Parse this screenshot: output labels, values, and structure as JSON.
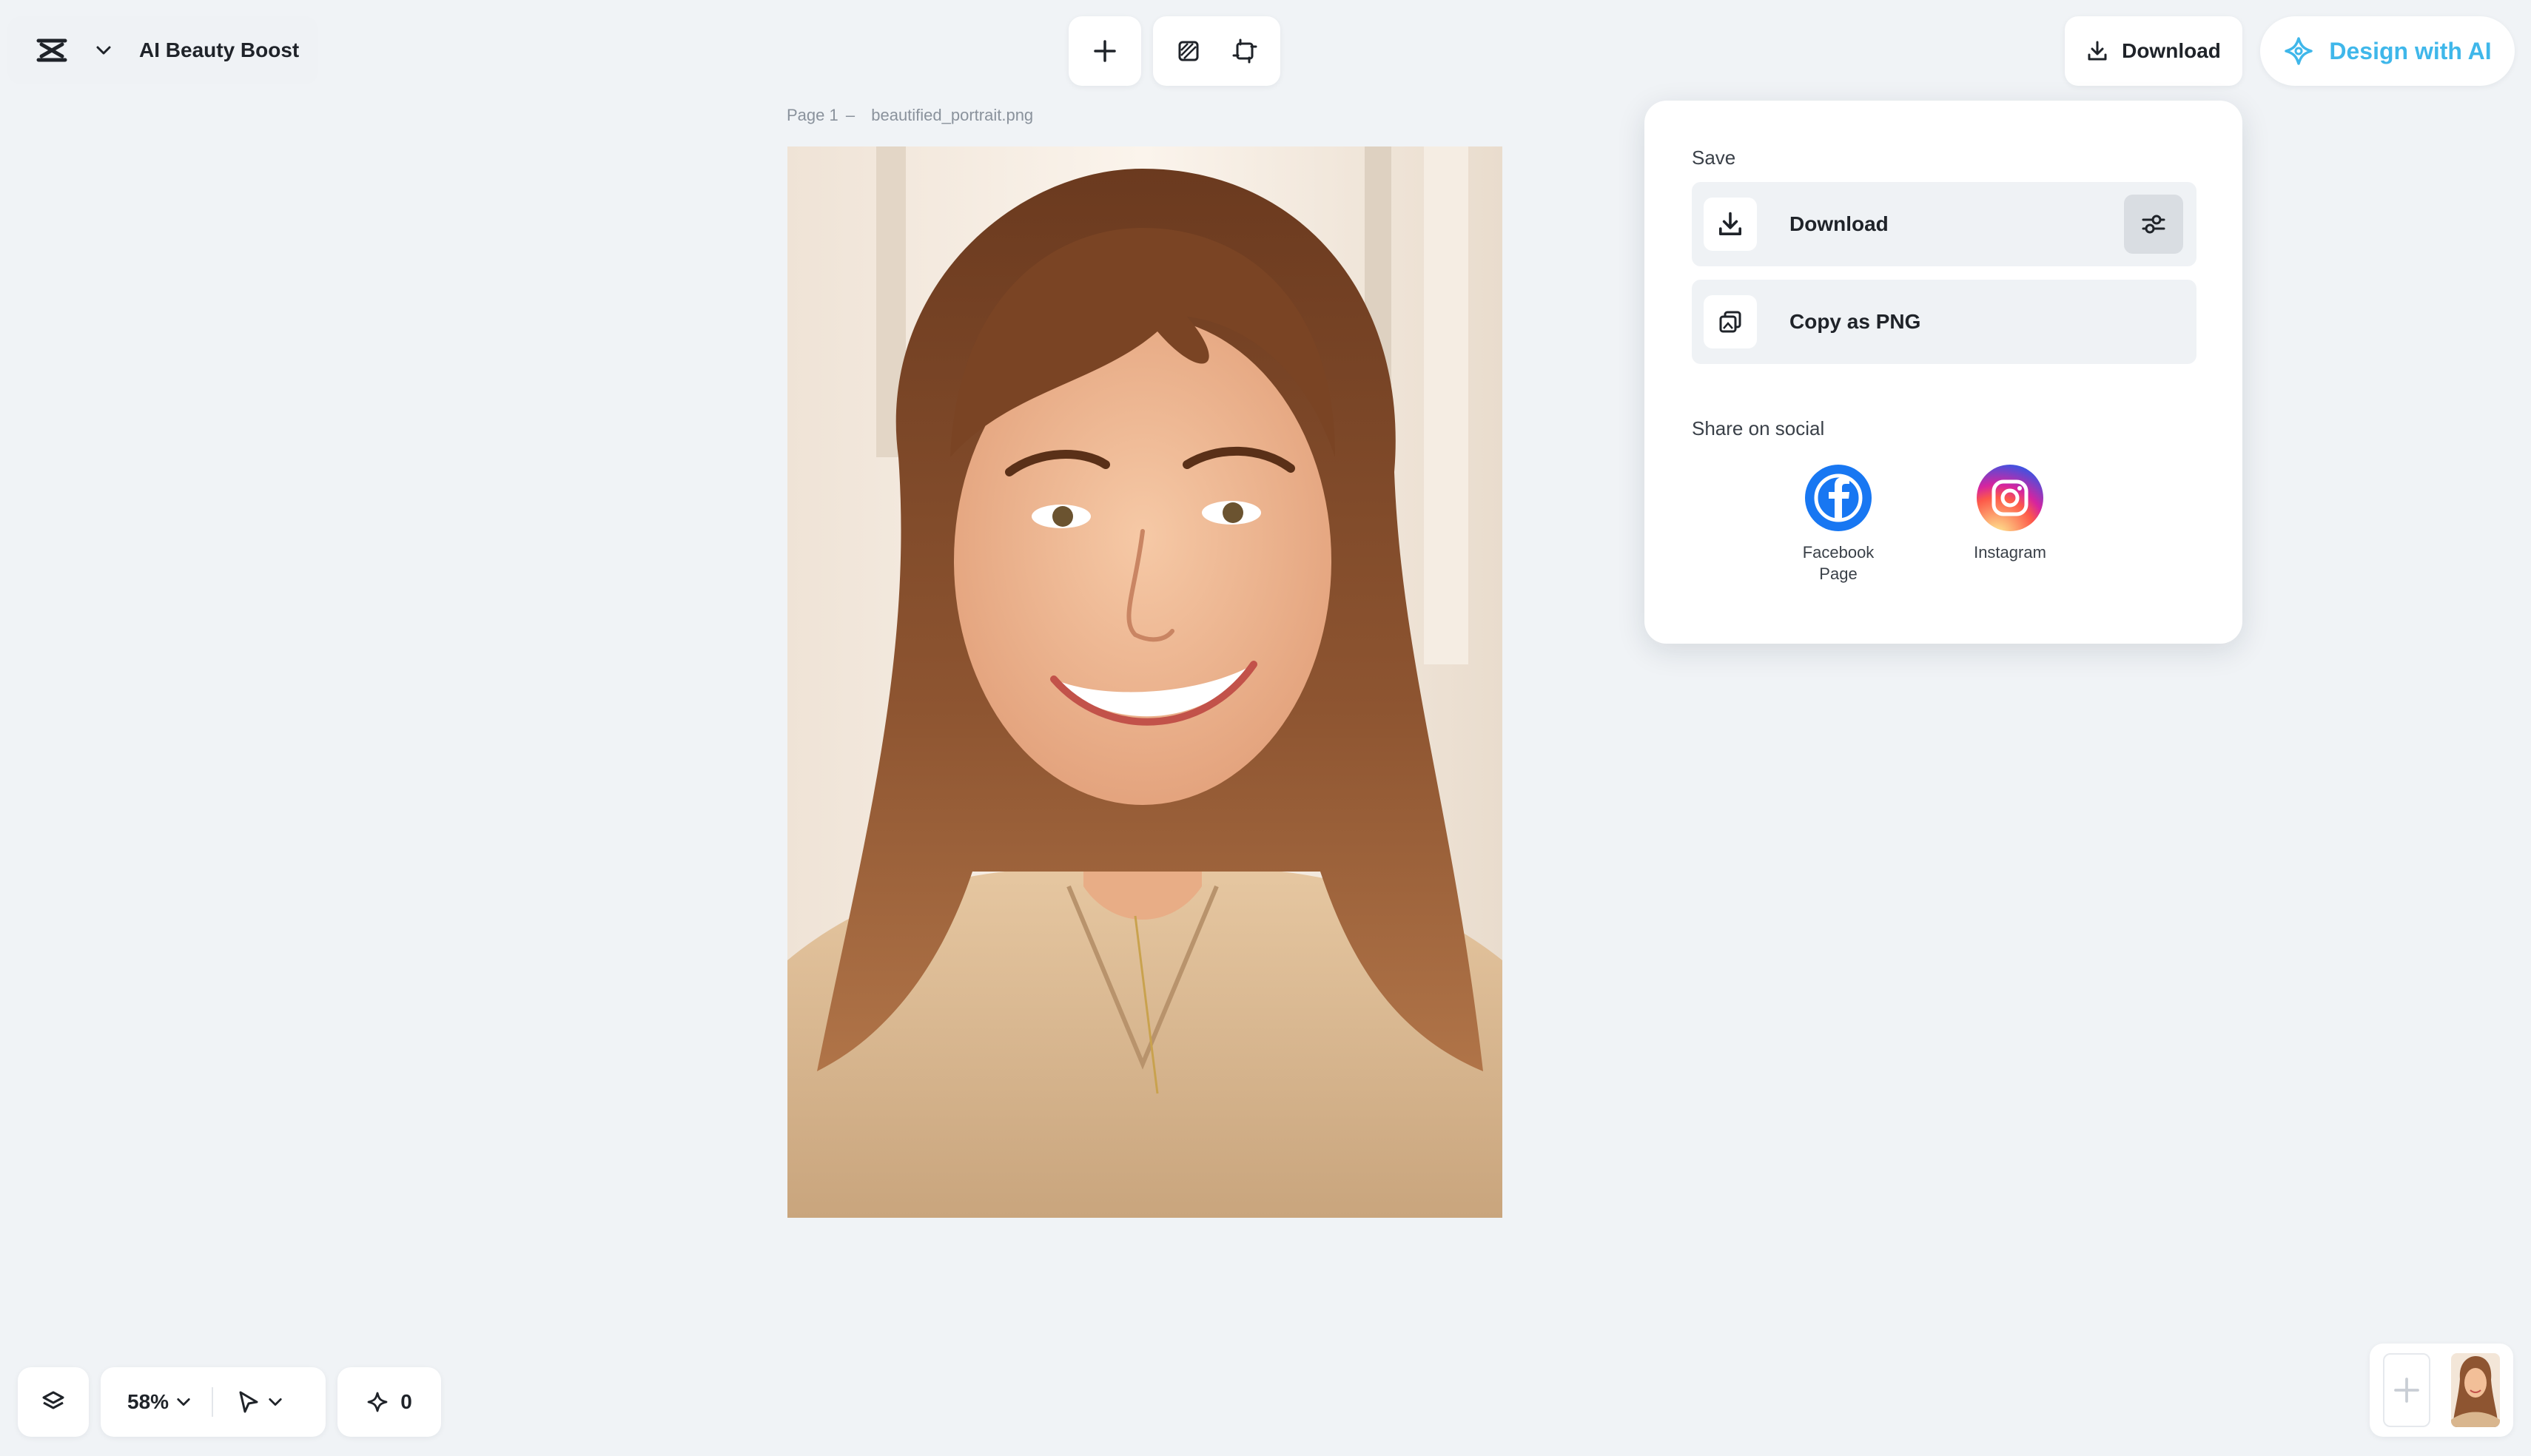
{
  "app": {
    "title": "AI Beauty Boost",
    "logo_icon": "capcut-logo-icon"
  },
  "toolbar": {
    "add_icon": "plus-icon",
    "tool_icons": [
      "background-remove-icon",
      "resize-icon"
    ]
  },
  "header": {
    "download_label": "Download",
    "design_ai_label": "Design with AI",
    "accent_color": "#3fb7ea"
  },
  "canvas": {
    "page_label": "Page 1",
    "separator": "–",
    "file_name": "beautified_portrait.png"
  },
  "download_menu": {
    "save_heading": "Save",
    "download_label": "Download",
    "copy_label": "Copy as PNG",
    "share_heading": "Share on social",
    "socials": [
      {
        "name_line1": "Facebook",
        "name_line2": "Page",
        "color": "#1877f2"
      },
      {
        "name_line1": "Instagram",
        "name_line2": "",
        "color": "#e1306c"
      }
    ]
  },
  "bottom_bar": {
    "zoom_value": "58%",
    "ai_credits": "0"
  }
}
